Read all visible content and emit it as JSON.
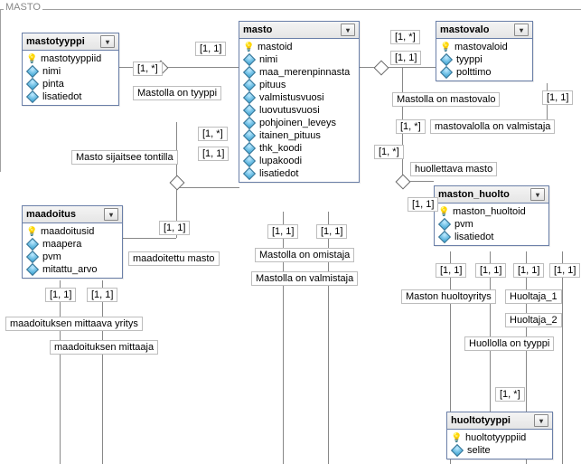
{
  "section": {
    "title": "MASTO"
  },
  "entities": {
    "mastotyyppi": {
      "title": "mastotyyppi",
      "attrs": [
        {
          "kind": "key",
          "name": "mastotyyppiid"
        },
        {
          "kind": "field",
          "name": "nimi"
        },
        {
          "kind": "field",
          "name": "pinta"
        },
        {
          "kind": "field",
          "name": "lisatiedot"
        }
      ]
    },
    "masto": {
      "title": "masto",
      "attrs": [
        {
          "kind": "key",
          "name": "mastoid"
        },
        {
          "kind": "field",
          "name": "nimi"
        },
        {
          "kind": "field",
          "name": "maa_merenpinnasta"
        },
        {
          "kind": "field",
          "name": "pituus"
        },
        {
          "kind": "field",
          "name": "valmistusvuosi"
        },
        {
          "kind": "field",
          "name": "luovutusvuosi"
        },
        {
          "kind": "field",
          "name": "pohjoinen_leveys"
        },
        {
          "kind": "field",
          "name": "itainen_pituus"
        },
        {
          "kind": "field",
          "name": "thk_koodi"
        },
        {
          "kind": "field",
          "name": "lupakoodi"
        },
        {
          "kind": "field",
          "name": "lisatiedot"
        }
      ]
    },
    "mastovalo": {
      "title": "mastovalo",
      "attrs": [
        {
          "kind": "key",
          "name": "mastovaloid"
        },
        {
          "kind": "field",
          "name": "tyyppi"
        },
        {
          "kind": "field",
          "name": "polttimo"
        }
      ]
    },
    "maadoitus": {
      "title": "maadoitus",
      "attrs": [
        {
          "kind": "key",
          "name": "maadoitusid"
        },
        {
          "kind": "field",
          "name": "maapera"
        },
        {
          "kind": "field",
          "name": "pvm"
        },
        {
          "kind": "field",
          "name": "mitattu_arvo"
        }
      ]
    },
    "maston_huolto": {
      "title": "maston_huolto",
      "attrs": [
        {
          "kind": "key",
          "name": "maston_huoltoid"
        },
        {
          "kind": "field",
          "name": "pvm"
        },
        {
          "kind": "field",
          "name": "lisatiedot"
        }
      ]
    },
    "huoltotyyppi": {
      "title": "huoltotyyppi",
      "attrs": [
        {
          "kind": "key",
          "name": "huoltotyyppiid"
        },
        {
          "kind": "field",
          "name": "selite"
        }
      ]
    }
  },
  "relations": {
    "mastolla_tyyppi": "Mastolla on tyyppi",
    "masto_sijaitsee": "Masto sijaitsee tontilla",
    "mastolla_mastovalo": "Mastolla on mastovalo",
    "mastovalo_valmistaja": "mastovalolla on valmistaja",
    "huollettava_masto": "huollettava masto",
    "maadoitettu_masto": "maadoitettu masto",
    "mastolla_omistaja": "Mastolla on omistaja",
    "mastolla_valmistaja": "Mastolla on valmistaja",
    "maadoituksen_mittaava": "maadoituksen mittaava yritys",
    "maadoituksen_mittaaja": "maadoituksen mittaaja",
    "maston_huoltoyritys": "Maston huoltoyritys",
    "huoltaja1": "Huoltaja_1",
    "huoltaja2": "Huoltaja_2",
    "huollolla_tyyppi": "Huollolla on tyyppi"
  },
  "cards": {
    "c1star": "[1, *]",
    "c11": "[1, 1]"
  },
  "chart_data": {
    "type": "table",
    "description": "ER diagram fragment (UML-like) for section MASTO",
    "entities": [
      {
        "name": "mastotyyppi",
        "pk": "mastotyyppiid",
        "fields": [
          "nimi",
          "pinta",
          "lisatiedot"
        ]
      },
      {
        "name": "masto",
        "pk": "mastoid",
        "fields": [
          "nimi",
          "maa_merenpinnasta",
          "pituus",
          "valmistusvuosi",
          "luovutusvuosi",
          "pohjoinen_leveys",
          "itainen_pituus",
          "thk_koodi",
          "lupakoodi",
          "lisatiedot"
        ]
      },
      {
        "name": "mastovalo",
        "pk": "mastovaloid",
        "fields": [
          "tyyppi",
          "polttimo"
        ]
      },
      {
        "name": "maadoitus",
        "pk": "maadoitusid",
        "fields": [
          "maapera",
          "pvm",
          "mitattu_arvo"
        ]
      },
      {
        "name": "maston_huolto",
        "pk": "maston_huoltoid",
        "fields": [
          "pvm",
          "lisatiedot"
        ]
      },
      {
        "name": "huoltotyyppi",
        "pk": "huoltotyyppiid",
        "fields": [
          "selite"
        ]
      }
    ],
    "relationships": [
      {
        "name": "Mastolla on tyyppi",
        "between": [
          "masto",
          "mastotyyppi"
        ],
        "card": [
          "[1, 1]",
          "[1, *]"
        ]
      },
      {
        "name": "Mastolla on mastovalo",
        "between": [
          "masto",
          "mastovalo"
        ],
        "card": [
          "[1, *]",
          "[1, 1]"
        ]
      },
      {
        "name": "mastovalolla on valmistaja",
        "between": [
          "mastovalo",
          "(external)"
        ],
        "card": [
          "[1, *]",
          "[1, 1]"
        ]
      },
      {
        "name": "huollettava masto",
        "between": [
          "masto",
          "maston_huolto"
        ],
        "card": [
          "[1, *]",
          "[1, 1]"
        ]
      },
      {
        "name": "Masto sijaitsee tontilla",
        "between": [
          "masto",
          "(external)"
        ],
        "card": [
          "[1, *]",
          "[1, 1]"
        ]
      },
      {
        "name": "maadoitettu masto",
        "between": [
          "maadoitus",
          "masto"
        ],
        "card": [
          "[1, 1]",
          "[1, *]"
        ]
      },
      {
        "name": "Mastolla on omistaja",
        "between": [
          "masto",
          "(external)"
        ],
        "card": [
          "[1, 1]",
          ""
        ]
      },
      {
        "name": "Mastolla on valmistaja",
        "between": [
          "masto",
          "(external)"
        ],
        "card": [
          "[1, 1]",
          ""
        ]
      },
      {
        "name": "maadoituksen mittaava yritys",
        "between": [
          "maadoitus",
          "(external)"
        ],
        "card": [
          "[1, 1]",
          ""
        ]
      },
      {
        "name": "maadoituksen mittaaja",
        "between": [
          "maadoitus",
          "(external)"
        ],
        "card": [
          "[1, 1]",
          ""
        ]
      },
      {
        "name": "Maston huoltoyritys",
        "between": [
          "maston_huolto",
          "(external)"
        ],
        "card": [
          "[1, 1]",
          ""
        ]
      },
      {
        "name": "Huoltaja_1",
        "between": [
          "maston_huolto",
          "(external)"
        ],
        "card": [
          "[1, 1]",
          ""
        ]
      },
      {
        "name": "Huoltaja_2",
        "between": [
          "maston_huolto",
          "(external)"
        ],
        "card": [
          "[1, 1]",
          ""
        ]
      },
      {
        "name": "Huollolla on tyyppi",
        "between": [
          "maston_huolto",
          "huoltotyyppi"
        ],
        "card": [
          "[1, 1]",
          "[1, *]"
        ]
      }
    ]
  }
}
